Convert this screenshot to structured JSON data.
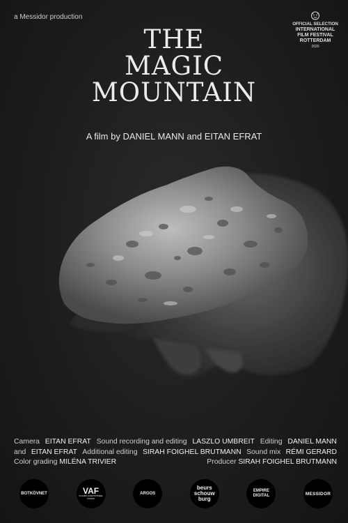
{
  "production": "a Messidor production",
  "laurel": {
    "line1": "OFFICIAL SELECTION",
    "line2": "INTERNATIONAL",
    "line3": "FILM FESTIVAL",
    "line4": "ROTTERDAM",
    "year": "2020",
    "icon": "tiger-head-icon"
  },
  "title": {
    "line1": "THE",
    "line2": "MAGIC",
    "line3": "MOUNTAIN"
  },
  "byline": "A film by DANIEL MANN and EITAN EFRAT",
  "image_description": "black-and-white hand holding a porous piece of rock",
  "credits": {
    "camera_label": "Camera",
    "camera": "EITAN EFRAT",
    "sound_label": "Sound recording and editing",
    "sound": "LASZLO UMBREIT",
    "editing_label": "Editing",
    "editing": "DANIEL MANN",
    "editing2_prefix": "and",
    "editing2": "EITAN EFRAT",
    "additional_label": "Additional editing",
    "additional": "SIRAH FOIGHEL BRUTMANN",
    "mix_label": "Sound mix",
    "mix": "RÉMI GERARD",
    "color_label": "Color grading",
    "color": "MILÉNA TRIVIER",
    "producer_label": "Producer",
    "producer": "SIRAH FOIGHEL BRUTMANN"
  },
  "logos": {
    "l1": "BOTKÖVNET",
    "l2_main": "VAF",
    "l2_sub": "VLAAMS AUDIOVISUEEL FONDS",
    "l3": "ARGOS",
    "l4_a": "beurs",
    "l4_b": "schouw",
    "l4_c": "burg",
    "l5": "EMPIRE DIGITAL",
    "l6": "MESSIDOR"
  }
}
